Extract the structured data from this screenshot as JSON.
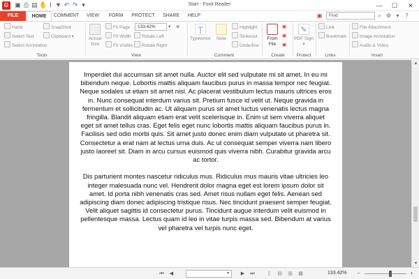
{
  "window": {
    "title": "Start - Foxit Reader",
    "app_logo": "G"
  },
  "quick_access": [
    {
      "name": "open-icon",
      "glyph": "▣"
    },
    {
      "name": "print-icon",
      "glyph": "⎙"
    },
    {
      "name": "save-icon",
      "glyph": "▤"
    },
    {
      "name": "hand-icon",
      "glyph": "✋"
    },
    {
      "name": "select-icon",
      "glyph": "Ⅰ"
    },
    {
      "name": "bookmark-icon",
      "glyph": "▼"
    },
    {
      "name": "undo-icon",
      "glyph": "↶"
    },
    {
      "name": "redo-icon",
      "glyph": "↷"
    },
    {
      "name": "customize-icon",
      "glyph": "▾"
    }
  ],
  "window_controls": {
    "minimize": "—",
    "maximize": "☐",
    "close": "✕"
  },
  "tabs": {
    "file": "FILE",
    "home": "HOME",
    "comment": "COMMENT",
    "view": "VIEW",
    "form": "FORM",
    "protect": "PROTECT",
    "share": "SHARE",
    "help": "HELP"
  },
  "search": {
    "placeholder": "Find",
    "icon": "search-icon"
  },
  "ribbon": {
    "tools": {
      "hand": "Hand",
      "select_text": "Select Text",
      "select_annotation": "Select Annotation",
      "snapshot": "SnapShot",
      "clipboard": "Clipboard",
      "label": "Tools"
    },
    "view": {
      "actual_size": "Actual Size",
      "fit_page": "Fit Page",
      "fit_width": "Fit Width",
      "fit_visible": "Fit Visible",
      "zoom_value": "133.42%",
      "rotate_left": "Rotate Left",
      "rotate_right": "Rotate Right",
      "label": "View"
    },
    "comment": {
      "typewriter": "Typewriter",
      "note": "Note",
      "highlight": "Highlight",
      "strikeout": "Strikeout",
      "underline": "Underline",
      "label": "Comment"
    },
    "create": {
      "from_file": "From File",
      "label": "Create"
    },
    "protect": {
      "pdf_sign": "PDF Sign",
      "label": "Protect"
    },
    "links": {
      "link": "Link",
      "bookmark": "Bookmark",
      "label": "Links"
    },
    "insert": {
      "file_attachment": "File Attachment",
      "image_annotation": "Image Annotation",
      "audio_video": "Audio & Video",
      "label": "Insert"
    }
  },
  "document": {
    "paragraphs": [
      "Imperdiet dui accumsan sit amet nulla. Auctor elit sed vulputate mi sit amet. In eu mi bibendum neque. Lobortis mattis aliquam faucibus purus in massa tempor nec feugiat. Neque sodales ut etiam sit amet nisl. Ac placerat vestibulum lectus mauris ultrices eros in. Nunc consequat interdum varius sit. Pretium fusce id velit ut. Neque gravida in fermentum et sollicitudin ac. Ut aliquam purus sit amet luctus venenatis lectus magna fringilla. Blandit aliquam etiam erat velit scelerisque in. Enim ut sem viverra aliquet eget sit amet tellus cras. Eget felis eget nunc lobortis mattis aliquam faucibus purus in. Facilisis sed odio morbi quis. Sit amet justo donec enim diam vulputate ut pharetra sit. Consectetur a erat nam at lectus urna duis. Ac ut consequat semper viverra nam libero justo laoreet sit. Diam in arcu cursus euismod quis viverra nibh. Curabitur gravida arcu ac tortor.",
      "Dis parturient montes nascetur ridiculus mus. Ridiculus mus mauris vitae ultricies leo integer malesuada nunc vel. Hendrerit dolor magna eget est lorem ipsum dolor sit amet. Id porta nibh venenatis cras sed. Amet risus nullam eget felis. Aenean sed adipiscing diam donec adipiscing tristique risus. Nec tincidunt praesent semper feugiat. Velit aliquet sagittis id consectetur purus. Tincidunt augue interdum velit euismod in pellentesque massa. Lectus quam id leo in vitae turpis massa sed. Bibendum at varius vel pharetra vel turpis nunc eget."
    ]
  },
  "statusbar": {
    "zoom_value": "133.42%",
    "first_page": "⏮",
    "prev_page": "◀",
    "next_page": "▶",
    "last_page": "⏭",
    "zoom_out": "−",
    "zoom_in": "+",
    "zoom_slider_fraction": 0.62
  }
}
